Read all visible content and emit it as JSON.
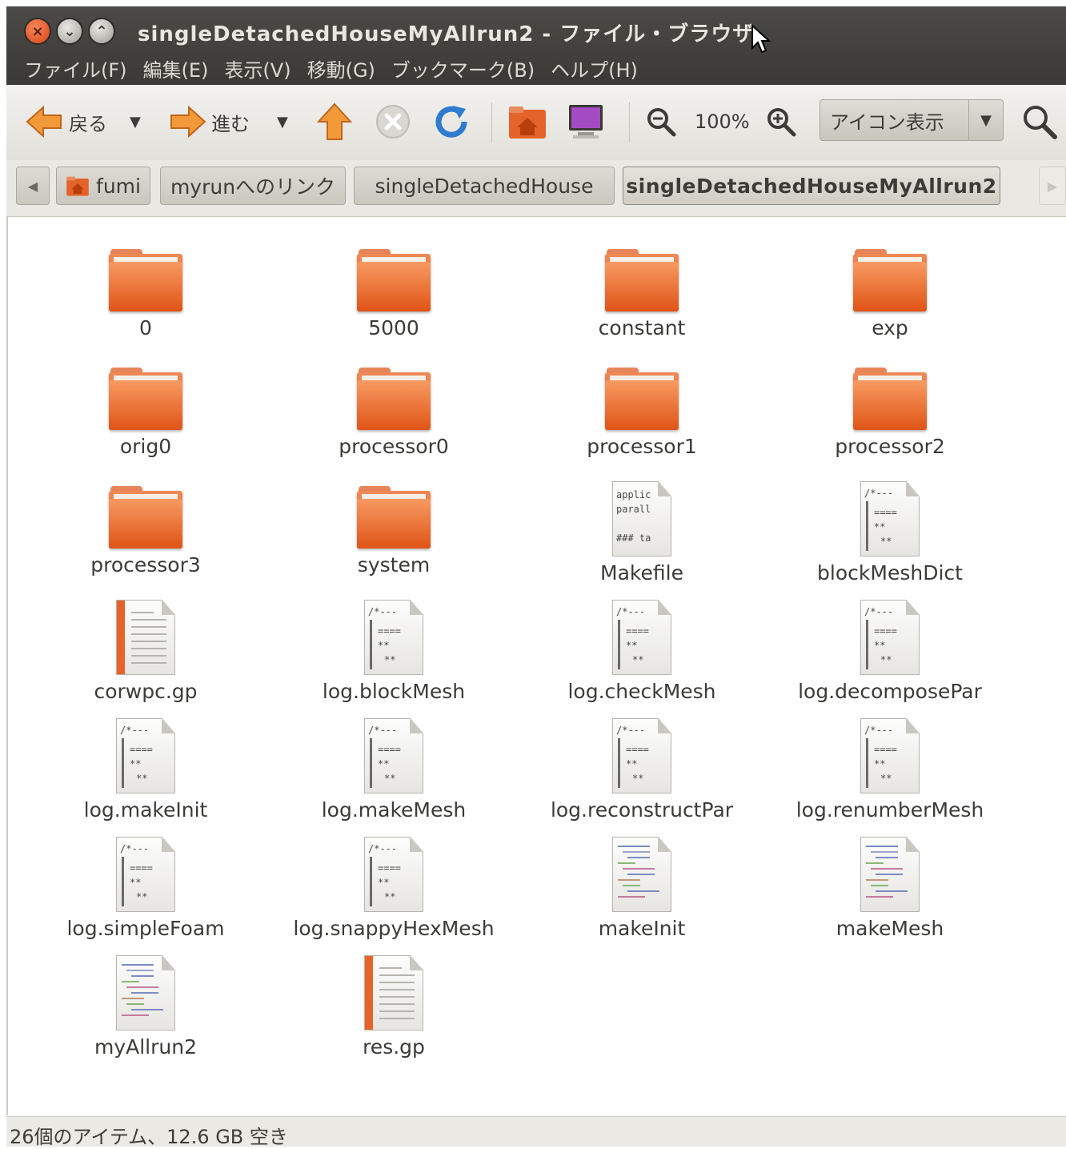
{
  "window": {
    "title": "singleDetachedHouseMyAllrun2 - ファイル・ブラウザ"
  },
  "menu": [
    "ファイル(F)",
    "編集(E)",
    "表示(V)",
    "移動(G)",
    "ブックマーク(B)",
    "ヘルプ(H)"
  ],
  "toolbar": {
    "back_label": "戻る",
    "forward_label": "進む",
    "zoom_level": "100%",
    "view_mode": "アイコン表示"
  },
  "pathbar": {
    "crumbs": [
      "fumi",
      "myrunへのリンク",
      "singleDetachedHouse",
      "singleDetachedHouseMyAllrun2"
    ]
  },
  "files": [
    {
      "name": "0",
      "type": "folder"
    },
    {
      "name": "5000",
      "type": "folder"
    },
    {
      "name": "constant",
      "type": "folder"
    },
    {
      "name": "exp",
      "type": "folder"
    },
    {
      "name": "orig0",
      "type": "folder"
    },
    {
      "name": "processor0",
      "type": "folder"
    },
    {
      "name": "processor1",
      "type": "folder"
    },
    {
      "name": "processor2",
      "type": "folder"
    },
    {
      "name": "processor3",
      "type": "folder"
    },
    {
      "name": "system",
      "type": "folder"
    },
    {
      "name": "Makefile",
      "type": "makefile",
      "preview": [
        "applic",
        "parall",
        "",
        "### ta"
      ]
    },
    {
      "name": "blockMeshDict",
      "type": "code"
    },
    {
      "name": "corwpc.gp",
      "type": "text"
    },
    {
      "name": "log.blockMesh",
      "type": "code"
    },
    {
      "name": "log.checkMesh",
      "type": "code"
    },
    {
      "name": "log.decomposePar",
      "type": "code"
    },
    {
      "name": "log.makeInit",
      "type": "code"
    },
    {
      "name": "log.makeMesh",
      "type": "code"
    },
    {
      "name": "log.reconstructPar",
      "type": "code"
    },
    {
      "name": "log.renumberMesh",
      "type": "code"
    },
    {
      "name": "log.simpleFoam",
      "type": "code"
    },
    {
      "name": "log.snappyHexMesh",
      "type": "code"
    },
    {
      "name": "makeInit",
      "type": "script"
    },
    {
      "name": "makeMesh",
      "type": "script"
    },
    {
      "name": "myAllrun2",
      "type": "script"
    },
    {
      "name": "res.gp",
      "type": "text"
    }
  ],
  "status": "26個のアイテム、12.6 GB 空き",
  "colors": {
    "titlebar": "#3a3935",
    "folder_orange": "#e05416",
    "close_button": "#d9461a"
  }
}
